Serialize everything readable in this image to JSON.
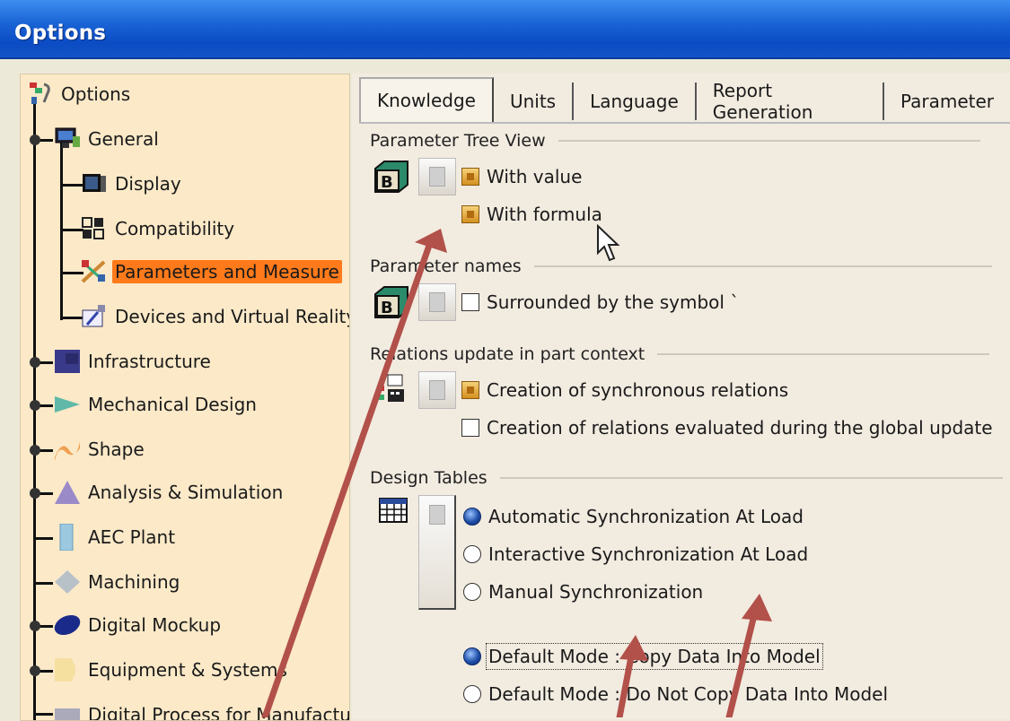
{
  "window": {
    "title": "Options"
  },
  "tree": {
    "root": "Options",
    "items": [
      {
        "label": "General"
      },
      {
        "label": "Display"
      },
      {
        "label": "Compatibility"
      },
      {
        "label": "Parameters and Measure",
        "selected": true
      },
      {
        "label": "Devices and Virtual Reality"
      },
      {
        "label": "Infrastructure"
      },
      {
        "label": "Mechanical Design"
      },
      {
        "label": "Shape"
      },
      {
        "label": "Analysis & Simulation"
      },
      {
        "label": "AEC Plant"
      },
      {
        "label": "Machining"
      },
      {
        "label": "Digital Mockup"
      },
      {
        "label": "Equipment & Systems"
      },
      {
        "label": "Digital Process for Manufactur"
      }
    ]
  },
  "tabs": [
    "Knowledge",
    "Units",
    "Language",
    "Report Generation",
    "Parameter"
  ],
  "sections": {
    "tree_view": {
      "title": "Parameter Tree View",
      "with_value": "With value",
      "with_formula": "With formula"
    },
    "names": {
      "title": "Parameter names",
      "surrounded": "Surrounded by the symbol `"
    },
    "relations": {
      "title": "Relations update in part context",
      "sync": "Creation of synchronous relations",
      "global": "Creation of relations evaluated during the global update"
    },
    "design_tables": {
      "title": "Design Tables",
      "auto": "Automatic Synchronization At Load",
      "interactive": "Interactive Synchronization At Load",
      "manual": "Manual Synchronization",
      "copy": "Default Mode : Copy Data Into Model",
      "nocopy": "Default Mode : Do Not Copy Data Into Model"
    }
  },
  "colors": {
    "selection": "#ff7a1a",
    "arrow": "#b2504a",
    "titlebar": "#1a64d6"
  },
  "icons": [
    "options-icon",
    "general-icon",
    "display-icon",
    "compatibility-icon",
    "parameters-icon",
    "devices-icon",
    "infrastructure-icon",
    "mechanical-icon",
    "shape-icon",
    "analysis-icon",
    "aec-icon",
    "machining-icon",
    "mockup-icon",
    "equipment-icon",
    "manufacturing-icon",
    "lock-icon",
    "b-box-icon",
    "table-icon",
    "mouse-cursor-icon"
  ]
}
